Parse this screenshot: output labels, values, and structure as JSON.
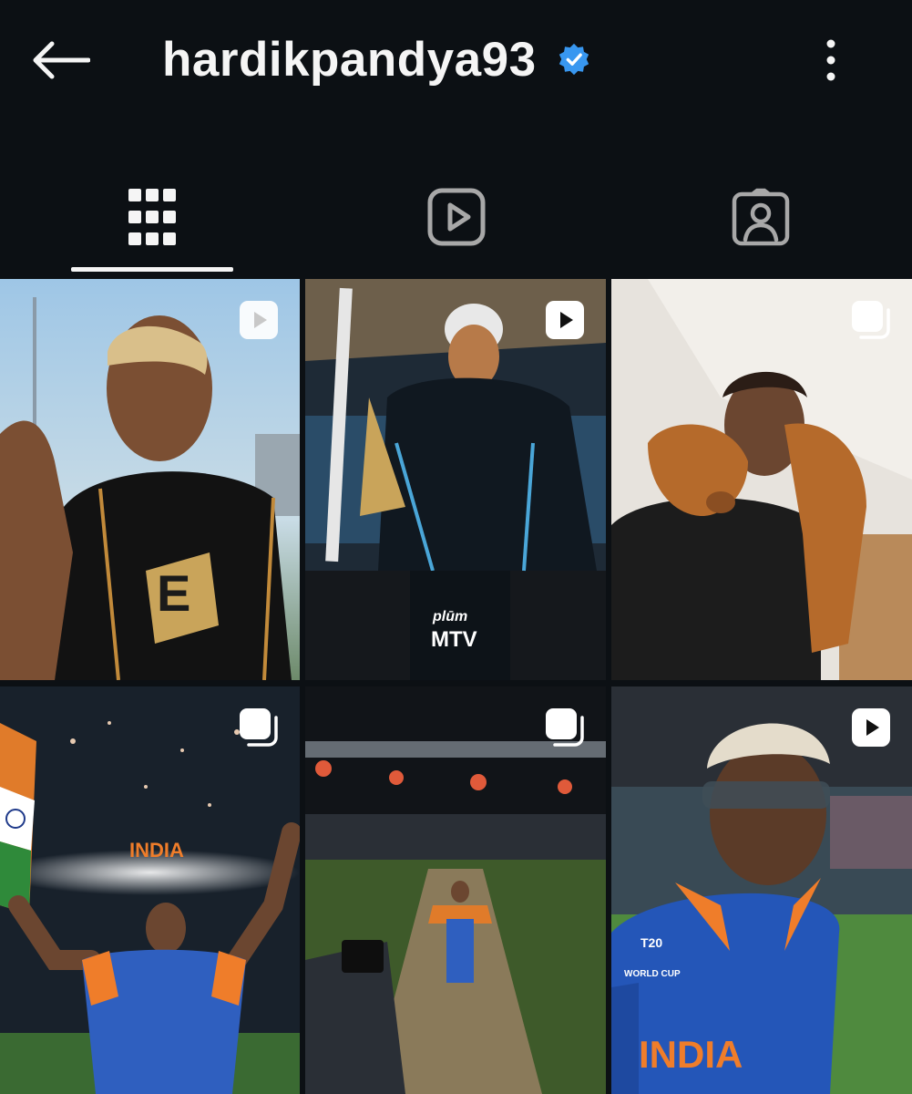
{
  "header": {
    "username": "hardikpandya93",
    "back_icon": "arrow-left-icon",
    "verified_icon": "verified-badge-icon",
    "verified_color": "#3897f0",
    "more_icon": "more-vertical-icon"
  },
  "tabs": [
    {
      "icon": "grid-icon",
      "active": true
    },
    {
      "icon": "reels-icon",
      "active": false
    },
    {
      "icon": "tagged-icon",
      "active": false
    }
  ],
  "posts": [
    {
      "type_icon": "reel-icon",
      "caption_text": "E"
    },
    {
      "type_icon": "reel-icon",
      "watermark_line1": "plūm",
      "watermark_line2": "MTV"
    },
    {
      "type_icon": "carousel-icon"
    },
    {
      "type_icon": "carousel-icon",
      "jersey_text": "INDIA"
    },
    {
      "type_icon": "carousel-icon"
    },
    {
      "type_icon": "reel-icon",
      "jersey_text": "INDIA",
      "logo_text": "T20",
      "logo_sub": "WORLD CUP"
    }
  ],
  "colors": {
    "background": "#0c1014",
    "text": "#f5f5f5",
    "icon_inactive": "#a8a8a8"
  }
}
